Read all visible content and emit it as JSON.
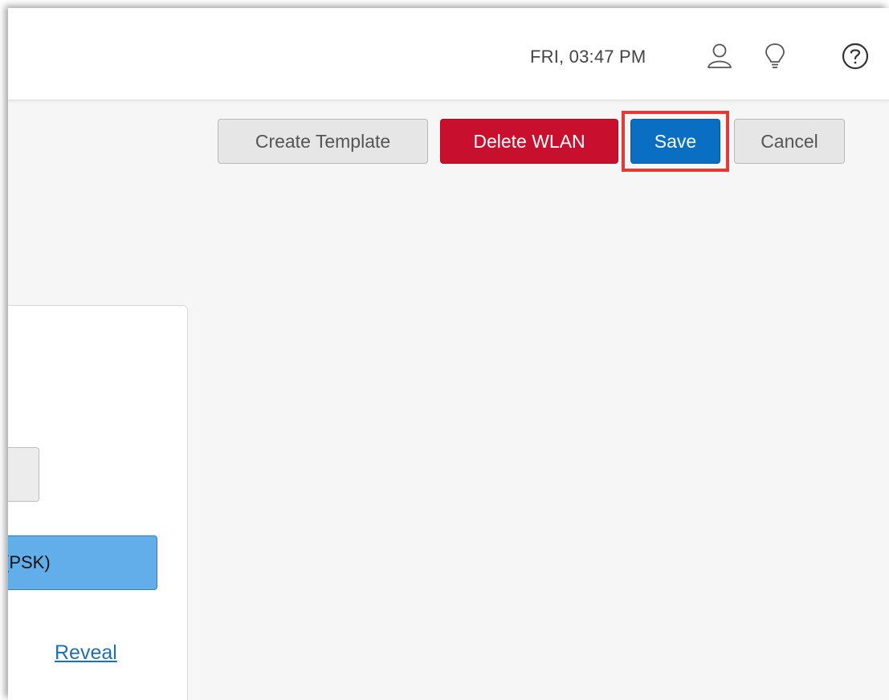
{
  "header": {
    "clock": "FRI, 03:47 PM",
    "icons": [
      "user-icon",
      "lightbulb-icon",
      "help-icon"
    ]
  },
  "toolbar": {
    "create_template_label": "Create Template",
    "delete_wlan_label": "Delete WLAN",
    "save_label": "Save",
    "cancel_label": "Cancel"
  },
  "panel": {
    "security_selected": "(PSK)",
    "reveal_label": "Reveal"
  },
  "colors": {
    "delete": "#c8102e",
    "save": "#0a6fc2",
    "highlight": "#e53935",
    "selected_option": "#62aeea"
  }
}
